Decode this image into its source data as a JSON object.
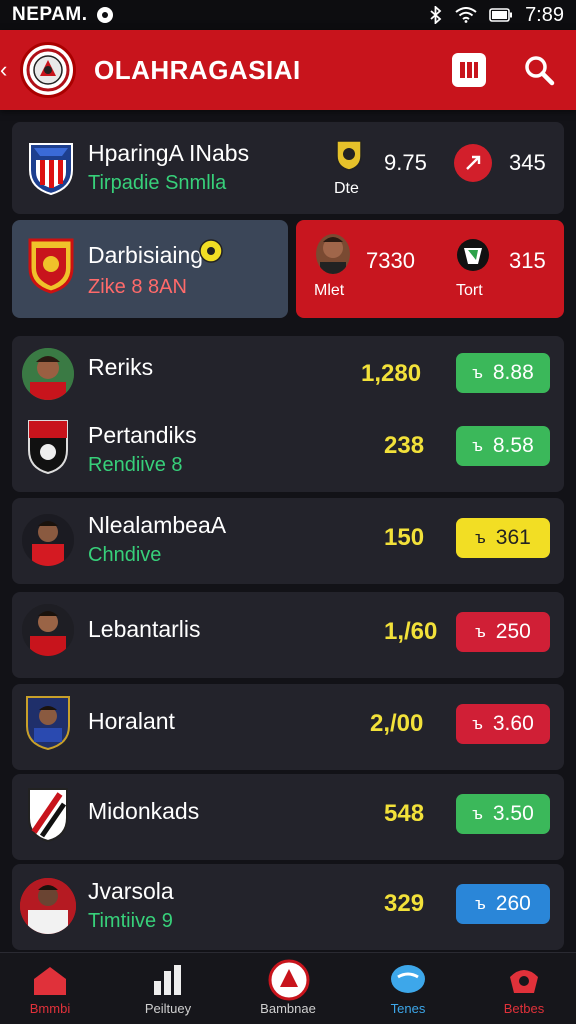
{
  "status_bar": {
    "carrier": "NEPAM.",
    "time": "7:89"
  },
  "header": {
    "title": "OLAHRAGASIAI"
  },
  "featured": [
    {
      "team": "HparingA INabs",
      "subtitle": "Tirpadie Snmlla",
      "score_label": "9.75",
      "mini_label": "Dte",
      "right_value": "345"
    }
  ],
  "featured_split": {
    "left": {
      "team": "Darbisiaing",
      "subtitle": "Zike 8 8AN"
    },
    "right": {
      "score": "7330",
      "player_label": "Mlet",
      "value": "315",
      "badge_label": "Tort"
    }
  },
  "rows": [
    {
      "name": "Reriks",
      "sub": "",
      "value": "1,280",
      "pill": "8.88",
      "pill_icon": "ъ",
      "color": "green"
    },
    {
      "name": "Pertandiks",
      "sub": "Rendiive 8",
      "value": "238",
      "pill": "8.58",
      "pill_icon": "ъ",
      "color": "green"
    },
    {
      "name": "NlealambeaA",
      "sub": "Chndive",
      "value": "150",
      "pill": "361",
      "pill_icon": "ъ",
      "color": "yellow"
    },
    {
      "name": "Lebantarlis",
      "sub": "",
      "value": "1,/60",
      "pill": "250",
      "pill_icon": "ъ",
      "color": "red"
    },
    {
      "name": "Horalant",
      "sub": "",
      "value": "2,/00",
      "pill": "3.60",
      "pill_icon": "ъ",
      "color": "red"
    },
    {
      "name": "Midonkads",
      "sub": "",
      "value": "548",
      "pill": "3.50",
      "pill_icon": "ъ",
      "color": "green"
    },
    {
      "name": "Jvarsola",
      "sub": "Timtiive 9",
      "value": "329",
      "pill": "260",
      "pill_icon": "ъ",
      "color": "blue"
    }
  ],
  "bottom_nav": [
    {
      "label": "Bmmbi",
      "color": "#e0313a"
    },
    {
      "label": "Peiltuey",
      "color": "#cfcfcf"
    },
    {
      "label": "Bambnae",
      "color": "#cfcfcf"
    },
    {
      "label": "Tenes",
      "color": "#3da7ea"
    },
    {
      "label": "Betbes",
      "color": "#e0313a"
    }
  ],
  "colors": {
    "accent": "#c8141c",
    "green": "#3bb85a",
    "yellow": "#f2de24",
    "red": "#d01f36",
    "blue": "#2a86d8"
  }
}
